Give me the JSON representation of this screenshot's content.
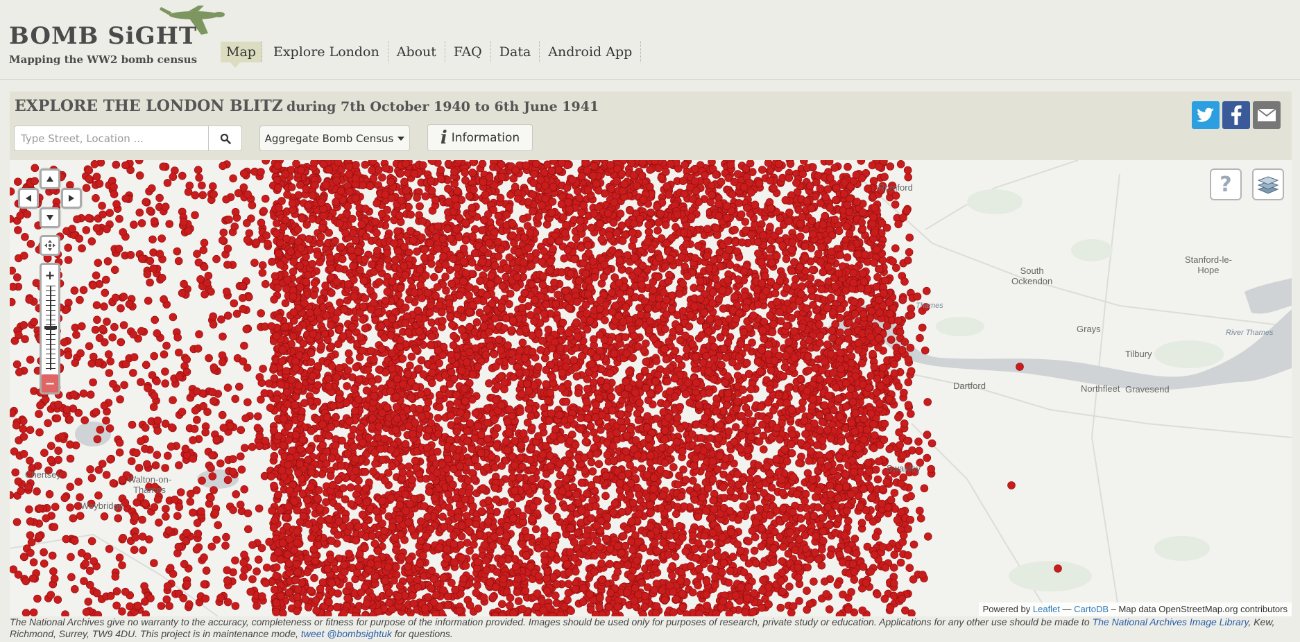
{
  "logo": {
    "title": "BOMB SiGHT",
    "subtitle": "Mapping the WW2 bomb census"
  },
  "nav": [
    {
      "label": "Map",
      "active": true
    },
    {
      "label": "Explore London"
    },
    {
      "label": "About"
    },
    {
      "label": "FAQ"
    },
    {
      "label": "Data"
    },
    {
      "label": "Android App"
    }
  ],
  "panel": {
    "title_main": "EXPLORE THE LONDON BLITZ",
    "title_range": "during 7th October 1940 to 6th June 1941",
    "search_placeholder": "Type Street, Location ...",
    "aggregate_label": "Aggregate Bomb Census",
    "information_label": "Information",
    "share": [
      "twitter-icon",
      "facebook-icon",
      "email-icon"
    ]
  },
  "map": {
    "bomb_color": "#c91c1c",
    "places": {
      "romford": "Romford",
      "south_ockendon": "South\nOckendon",
      "stanford": "Stanford-le-\nHope",
      "thames": "Thames",
      "river_thames": "River Thames",
      "grays": "Grays",
      "tilbury": "Tilbury",
      "dartford": "Dartford",
      "northfleet": "Northfleet",
      "gravesend": "Gravesend",
      "swanley": "Swanley",
      "chertsey": "Chertsey",
      "walton": "Walton-on-\nThames",
      "weybridge": "Weybridge"
    },
    "attribution": {
      "prefix": "Powered by",
      "leaflet": "Leaflet",
      "sep": " — ",
      "cartodb": "CartoDB",
      "rest": " – Map data OpenStreetMap.org contributors"
    }
  },
  "footer": {
    "text1": "The National Archives give no warranty to the accuracy, completeness or fitness for purpose of the information provided. Images should be used only for purposes of research, private study or education. Applications for any other use should be made to ",
    "link1": "The National Archives Image Library",
    "text2": ", Kew, Richmond, Surrey, TW9 4DU. This project is in maintenance mode, ",
    "link2": "tweet @bombsightuk",
    "text3": " for questions."
  }
}
